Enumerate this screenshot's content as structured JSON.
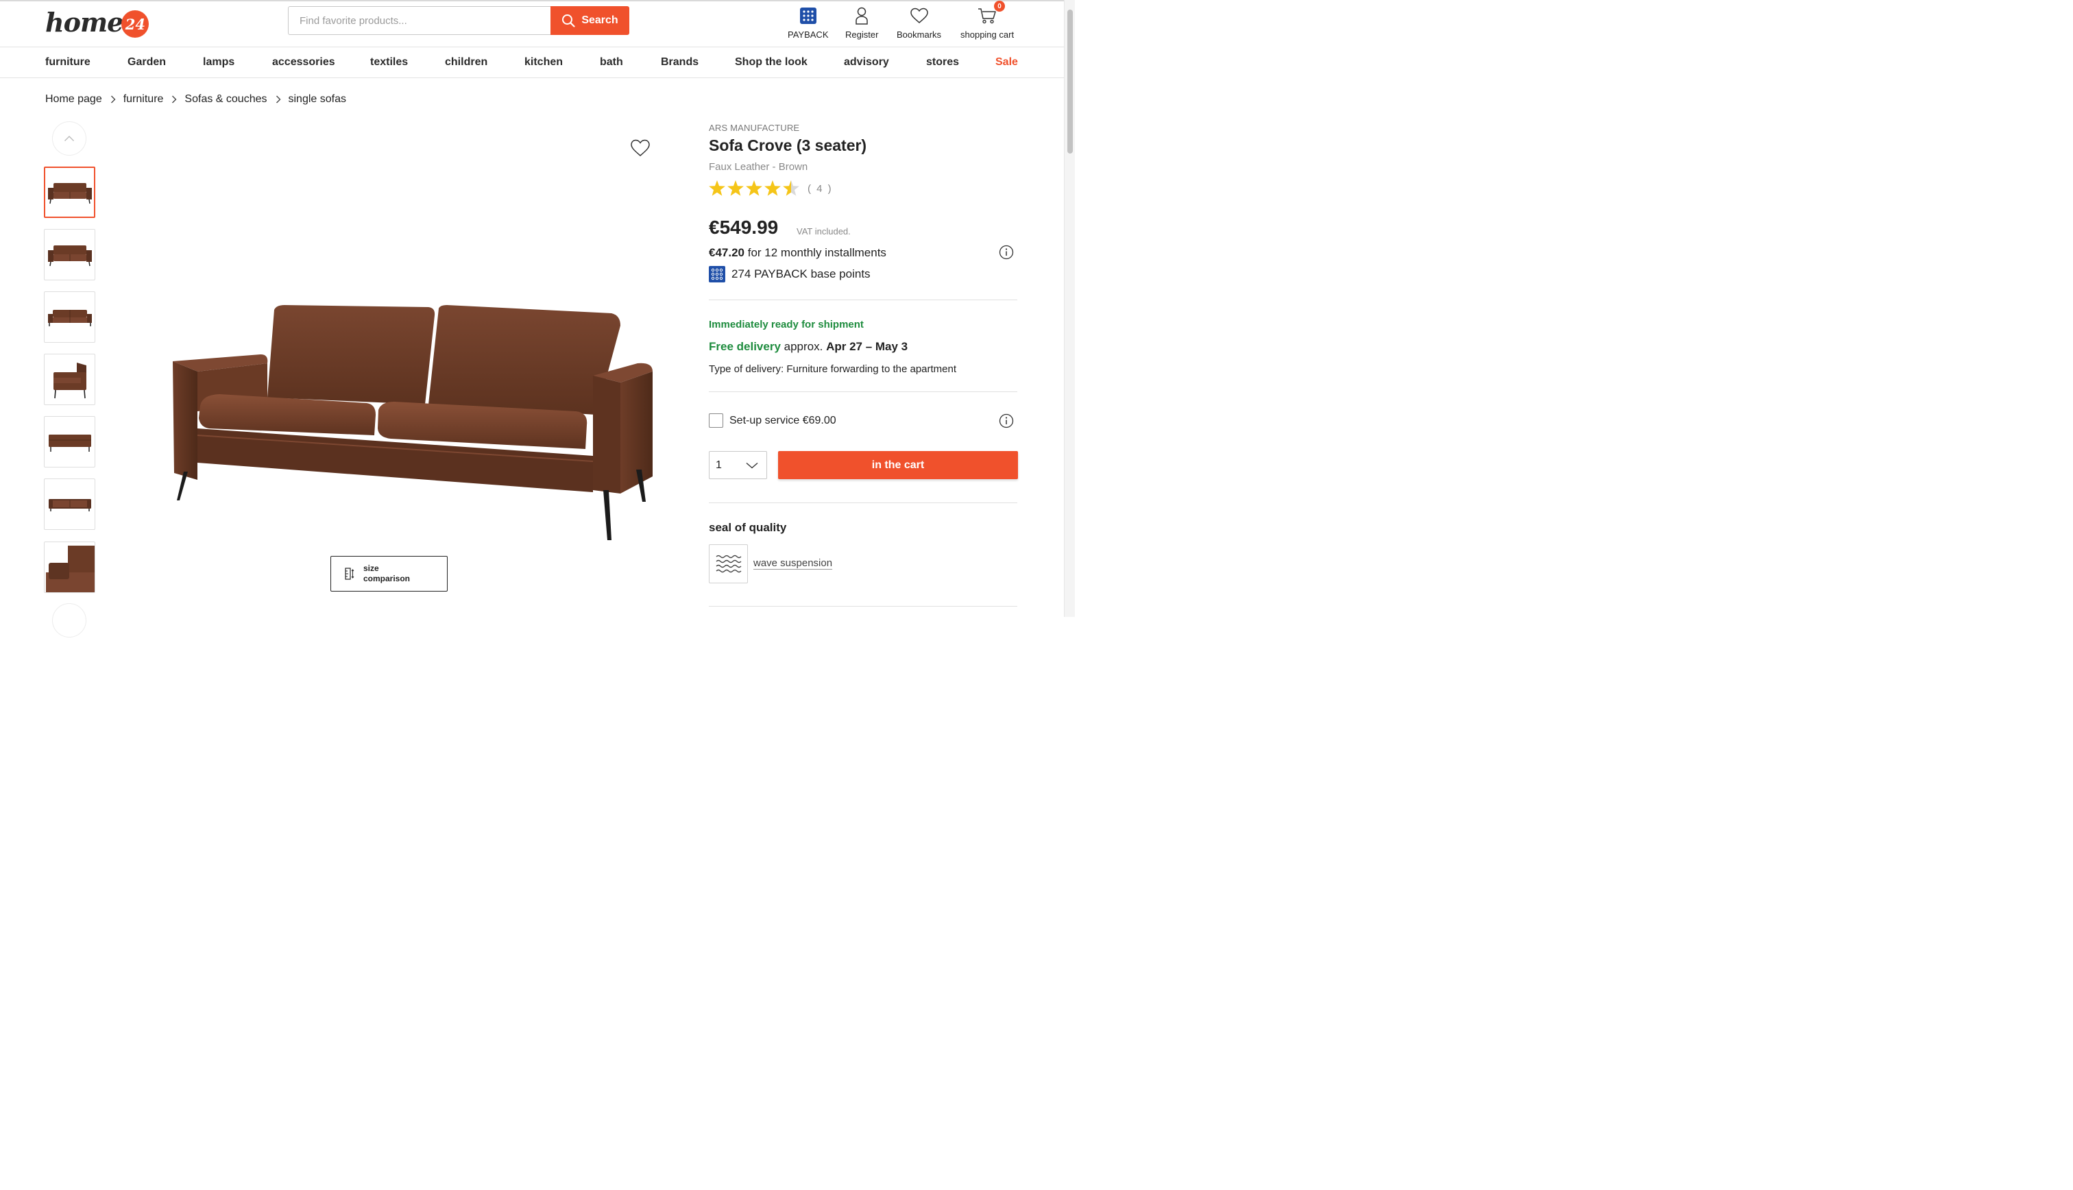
{
  "header": {
    "logo_text": "home",
    "logo_badge": "24",
    "search_placeholder": "Find favorite products...",
    "search_button": "Search",
    "payback_label": "PAYBACK",
    "register_label": "Register",
    "bookmarks_label": "Bookmarks",
    "cart_label": "shopping cart",
    "cart_count": "0"
  },
  "nav": {
    "items": [
      "furniture",
      "Garden",
      "lamps",
      "accessories",
      "textiles",
      "children",
      "kitchen",
      "bath",
      "Brands",
      "Shop the look",
      "advisory",
      "stores"
    ],
    "sale": "Sale"
  },
  "breadcrumb": [
    "Home page",
    "furniture",
    "Sofas & couches",
    "single sofas"
  ],
  "gallery": {
    "size_button": "size comparison"
  },
  "product": {
    "manufacturer": "ARS MANUFACTURE",
    "title": "Sofa Crove (3 seater)",
    "variant": "Faux Leather - Brown",
    "rating_value": 4.5,
    "rating_count": "( 4 )",
    "price": "€549.99",
    "vat_note": "VAT included.",
    "installment_amount": "€47.20",
    "installment_text": "for 12 monthly installments",
    "payback_points": "274 PAYBACK base points",
    "ready_text": "Immediately ready for shipment",
    "free_delivery": "Free delivery",
    "delivery_approx": "approx.",
    "delivery_dates": "Apr 27 – May 3",
    "delivery_type": "Type of delivery: Furniture forwarding to the apartment",
    "setup_service": "Set-up service €69.00",
    "quantity": "1",
    "cart_button": "in the cart",
    "seal_title": "seal of quality",
    "seal_item": "wave suspension"
  },
  "colors": {
    "accent": "#f0512c",
    "green": "#1e8c3e",
    "star": "#f5c518",
    "payback_blue": "#1f4fa8",
    "leather": "#6b3b26"
  }
}
